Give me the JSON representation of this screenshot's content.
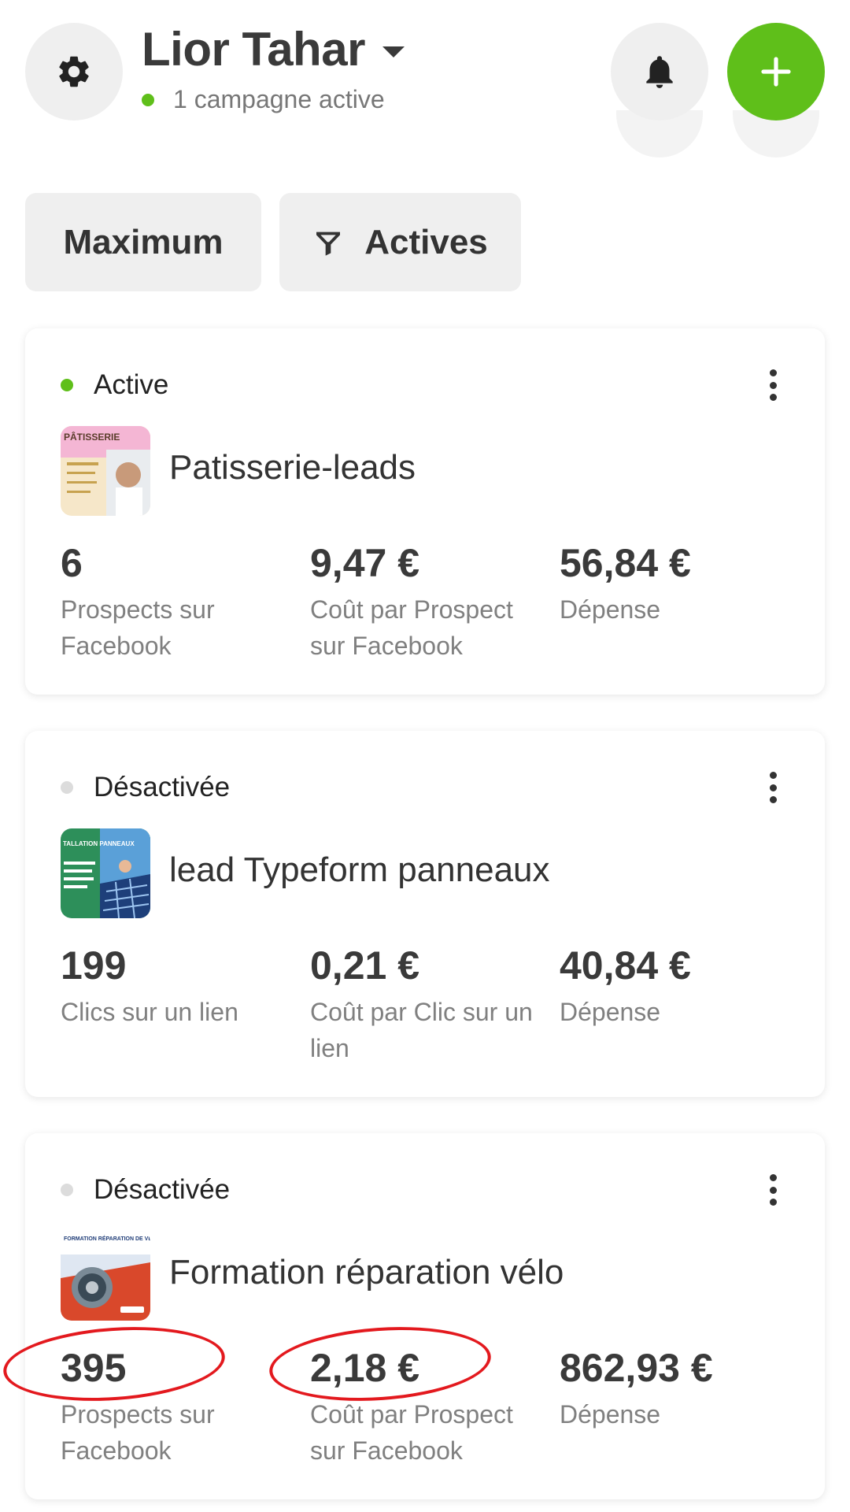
{
  "header": {
    "account_name": "Lior Tahar",
    "active_count_label": "1 campagne active"
  },
  "icons": {
    "settings": "gear-icon",
    "notifications": "bell-icon",
    "add": "plus-icon",
    "account_switch": "caret-down-icon",
    "filter": "funnel-icon",
    "more": "vertical-dots-icon"
  },
  "filters": {
    "date_range": "Maximum",
    "status": "Actives"
  },
  "colors": {
    "accent_green": "#5fbf1a",
    "inactive_grey": "#dcdcdc",
    "annotation_red": "#e3191e"
  },
  "campaigns": [
    {
      "status": "Active",
      "name": "Patisserie-leads",
      "thumb_text": "PÂTISSERIE",
      "metrics": [
        {
          "value": "6",
          "label": "Prospects sur Facebook"
        },
        {
          "value": "9,47 €",
          "label": "Coût par Prospect sur Facebook"
        },
        {
          "value": "56,84 €",
          "label": "Dépense"
        }
      ]
    },
    {
      "status": "Désactivée",
      "name": "lead Typeform panneaux",
      "thumb_text": "TALLATION PANNEAUX",
      "metrics": [
        {
          "value": "199",
          "label": "Clics sur un lien"
        },
        {
          "value": "0,21 €",
          "label": "Coût par Clic sur un lien"
        },
        {
          "value": "40,84 €",
          "label": "Dépense"
        }
      ]
    },
    {
      "status": "Désactivée",
      "name": "Formation réparation vélo",
      "thumb_text": "FORMATION RÉPARATION DE VÉLO",
      "metrics": [
        {
          "value": "395",
          "label": "Prospects sur Facebook"
        },
        {
          "value": "2,18 €",
          "label": "Coût par Prospect sur Facebook"
        },
        {
          "value": "862,93 €",
          "label": "Dépense"
        }
      ]
    }
  ]
}
